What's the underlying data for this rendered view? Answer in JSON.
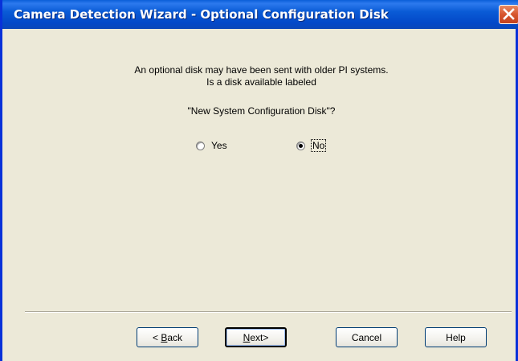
{
  "window": {
    "title": "Camera Detection Wizard - Optional Configuration Disk",
    "close_icon": "close-icon"
  },
  "message": {
    "line1": "An optional disk may have been sent with older PI systems.",
    "line2": "Is a disk available labeled",
    "line3": "\"New System Configuration Disk\"?"
  },
  "options": {
    "yes_label": "Yes",
    "no_label": "No",
    "selected": "No"
  },
  "buttons": {
    "back_arrow": "<",
    "back_mnemonic": "B",
    "back_rest": "ack",
    "next_mnemonic": "N",
    "next_rest": "ext",
    "next_arrow": ">",
    "cancel_label": "Cancel",
    "help_label": "Help"
  }
}
